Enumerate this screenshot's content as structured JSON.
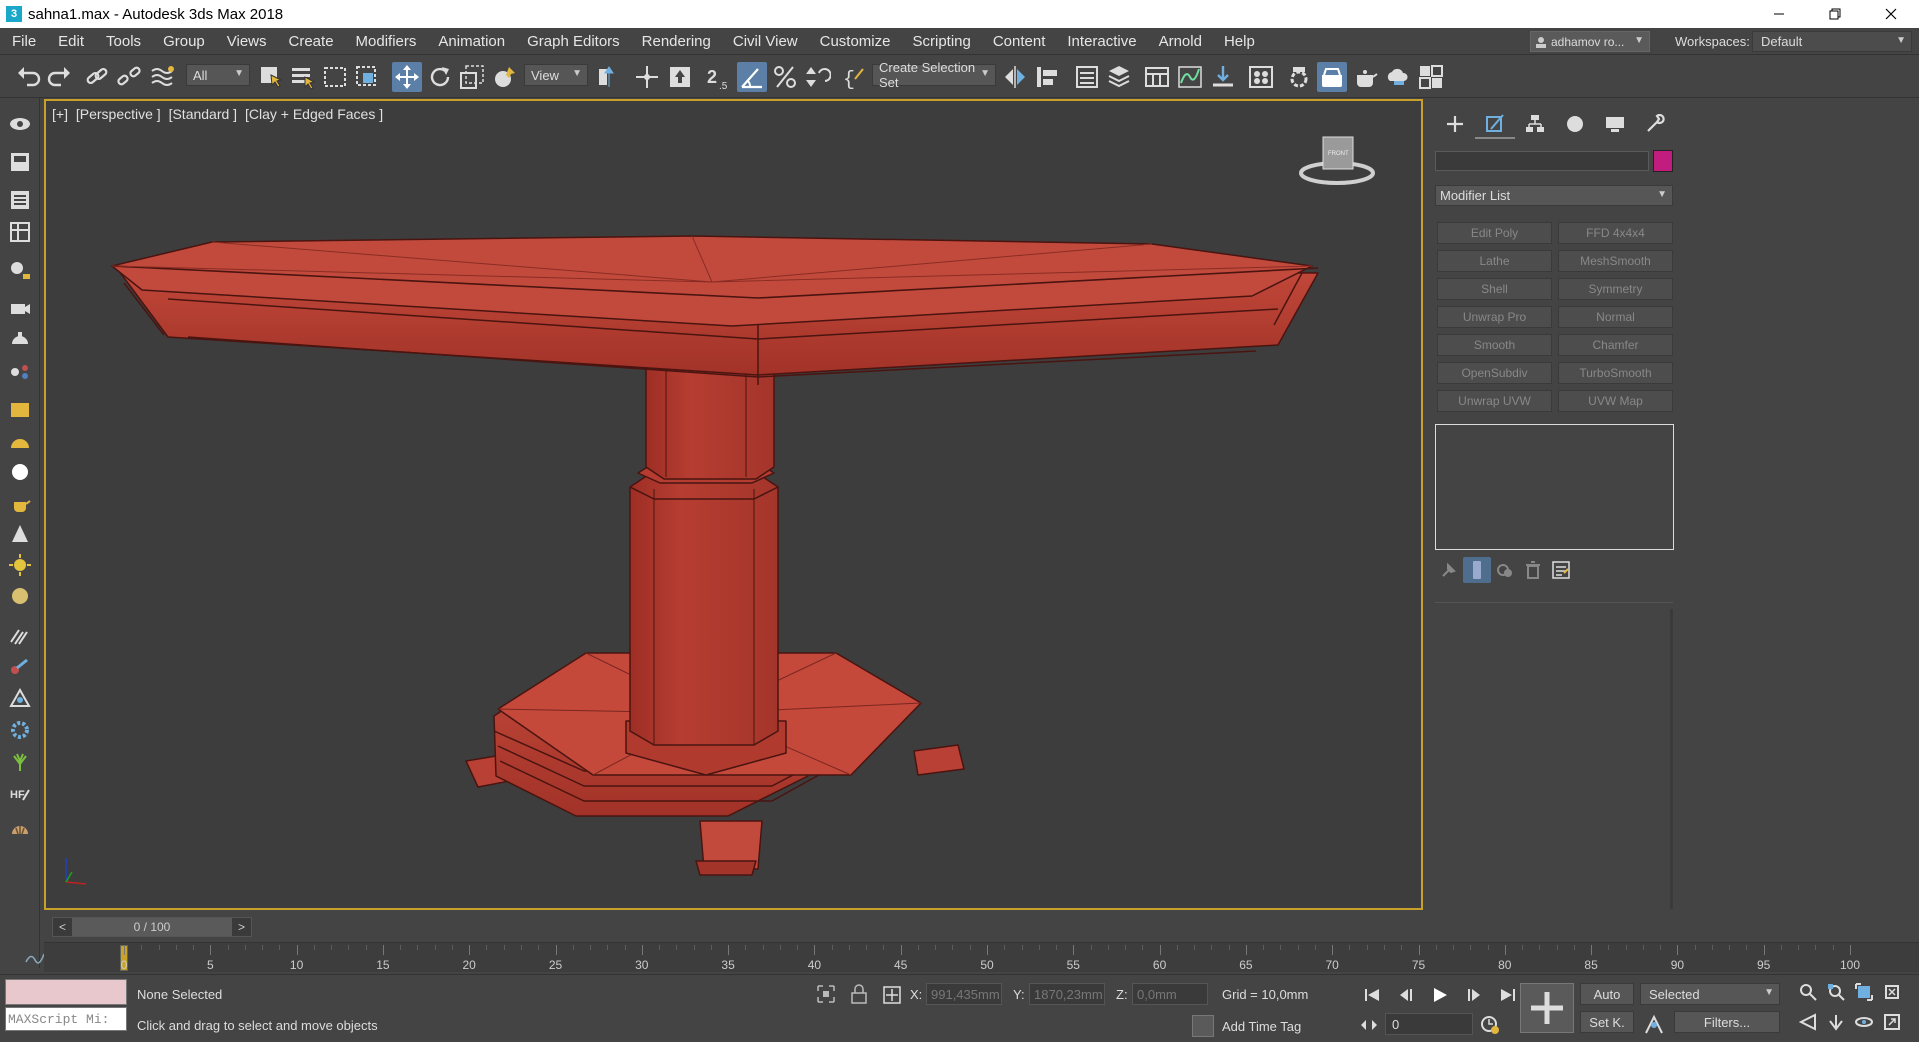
{
  "window": {
    "app_icon": "3",
    "title": "sahna1.max - Autodesk 3ds Max 2018",
    "minimize_icon": "minimize-icon",
    "restore_icon": "restore-icon",
    "close_icon": "close-icon"
  },
  "menu": {
    "items": [
      "File",
      "Edit",
      "Tools",
      "Group",
      "Views",
      "Create",
      "Modifiers",
      "Animation",
      "Graph Editors",
      "Rendering",
      "Civil View",
      "Customize",
      "Scripting",
      "Content",
      "Interactive",
      "Arnold",
      "Help"
    ],
    "user": "adhamov ro...",
    "workspaces_label": "Workspaces:",
    "workspace_value": "Default"
  },
  "toolbar": {
    "selection_filter": "All",
    "ref_coord": "View",
    "selection_set": "Create Selection Set",
    "snap_label": "2.5"
  },
  "viewport": {
    "label_plus": "[+]",
    "label_view": "[Perspective ]",
    "label_std": "[Standard ]",
    "label_shading": "[Clay + Edged Faces ]",
    "object_color": "#b53b2f",
    "viewcube_face": "FRONT"
  },
  "command_panel": {
    "modifier_list": "Modifier List",
    "modifier_buttons": [
      "Edit Poly",
      "FFD 4x4x4",
      "Lathe",
      "MeshSmooth",
      "Shell",
      "Symmetry",
      "Unwrap Pro",
      "Normal",
      "Smooth",
      "Chamfer",
      "OpenSubdiv",
      "TurboSmooth",
      "Unwrap UVW",
      "UVW Map"
    ],
    "object_color": "#c21c7e"
  },
  "timeline": {
    "frame_display": "0 / 100",
    "prev_arrow": "<",
    "next_arrow": ">",
    "ruler_labels": [
      "0",
      "5",
      "10",
      "15",
      "20",
      "25",
      "30",
      "35",
      "40",
      "45",
      "50",
      "55",
      "60",
      "65",
      "70",
      "75",
      "80",
      "85",
      "90",
      "95",
      "100"
    ]
  },
  "status": {
    "maxscript_placeholder": "MAXScript Mi:",
    "selection": "None Selected",
    "hint": "Click and drag to select and move objects",
    "x_label": "X:",
    "x_value": "991,435mm",
    "y_label": "Y:",
    "y_value": "1870,23mm",
    "z_label": "Z:",
    "z_value": "0,0mm",
    "grid": "Grid = 10,0mm",
    "add_time_tag": "Add Time Tag",
    "current_frame": "0",
    "auto_key": "Auto",
    "set_key": "Set K.",
    "key_filter": "Selected",
    "filters": "Filters..."
  }
}
